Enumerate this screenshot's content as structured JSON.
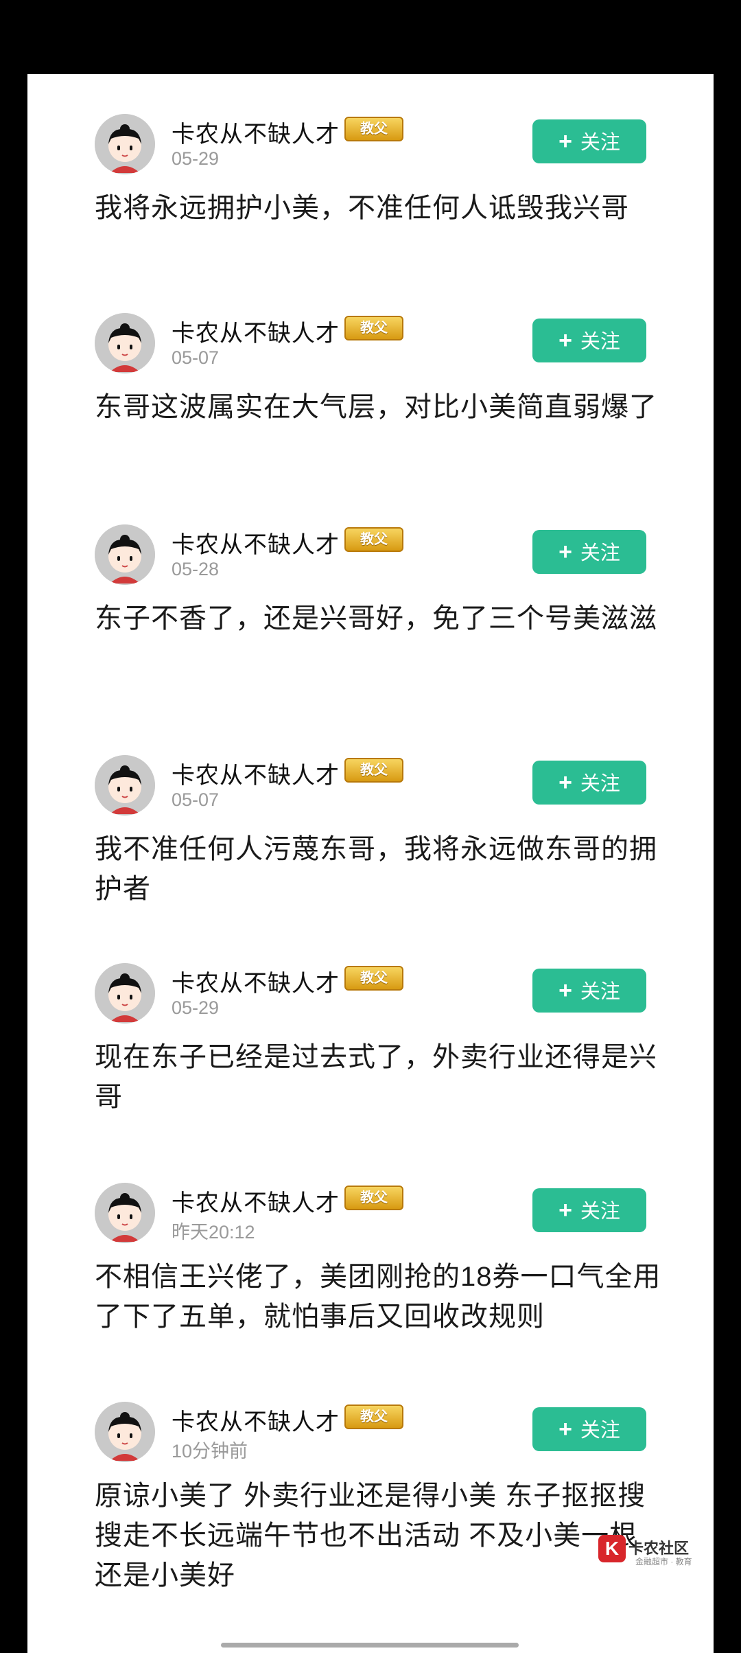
{
  "follow_label": "关注",
  "badge_label": "教父",
  "posts": [
    {
      "user": "卡农从不缺人才",
      "date": "05-29",
      "text": "我将永远拥护小美，不准任何人诋毁我兴哥"
    },
    {
      "user": "卡农从不缺人才",
      "date": "05-07",
      "text": "东哥这波属实在大气层，对比小美简直弱爆了"
    },
    {
      "user": "卡农从不缺人才",
      "date": "05-28",
      "text": "东子不香了，还是兴哥好，免了三个号美滋滋"
    },
    {
      "user": "卡农从不缺人才",
      "date": "05-07",
      "text": "我不准任何人污蔑东哥，我将永远做东哥的拥护者"
    },
    {
      "user": "卡农从不缺人才",
      "date": "05-29",
      "text": "现在东子已经是过去式了，外卖行业还得是兴哥"
    },
    {
      "user": "卡农从不缺人才",
      "date": "昨天20:12",
      "text": "不相信王兴佬了，美团刚抢的18券一口气全用了下了五单，就怕事后又回收改规则"
    },
    {
      "user": "卡农从不缺人才",
      "date": "10分钟前",
      "text": "原谅小美了 外卖行业还是得小美 东子抠抠搜搜走不长远端午节也不出活动 不及小美一根 还是小美好"
    }
  ],
  "watermark": {
    "logo": "K",
    "title": "卡农社区",
    "subtitle": "金融超市 · 教育"
  },
  "colors": {
    "follow_button": "#2bbd93",
    "badge_gold": "#e0a825"
  }
}
